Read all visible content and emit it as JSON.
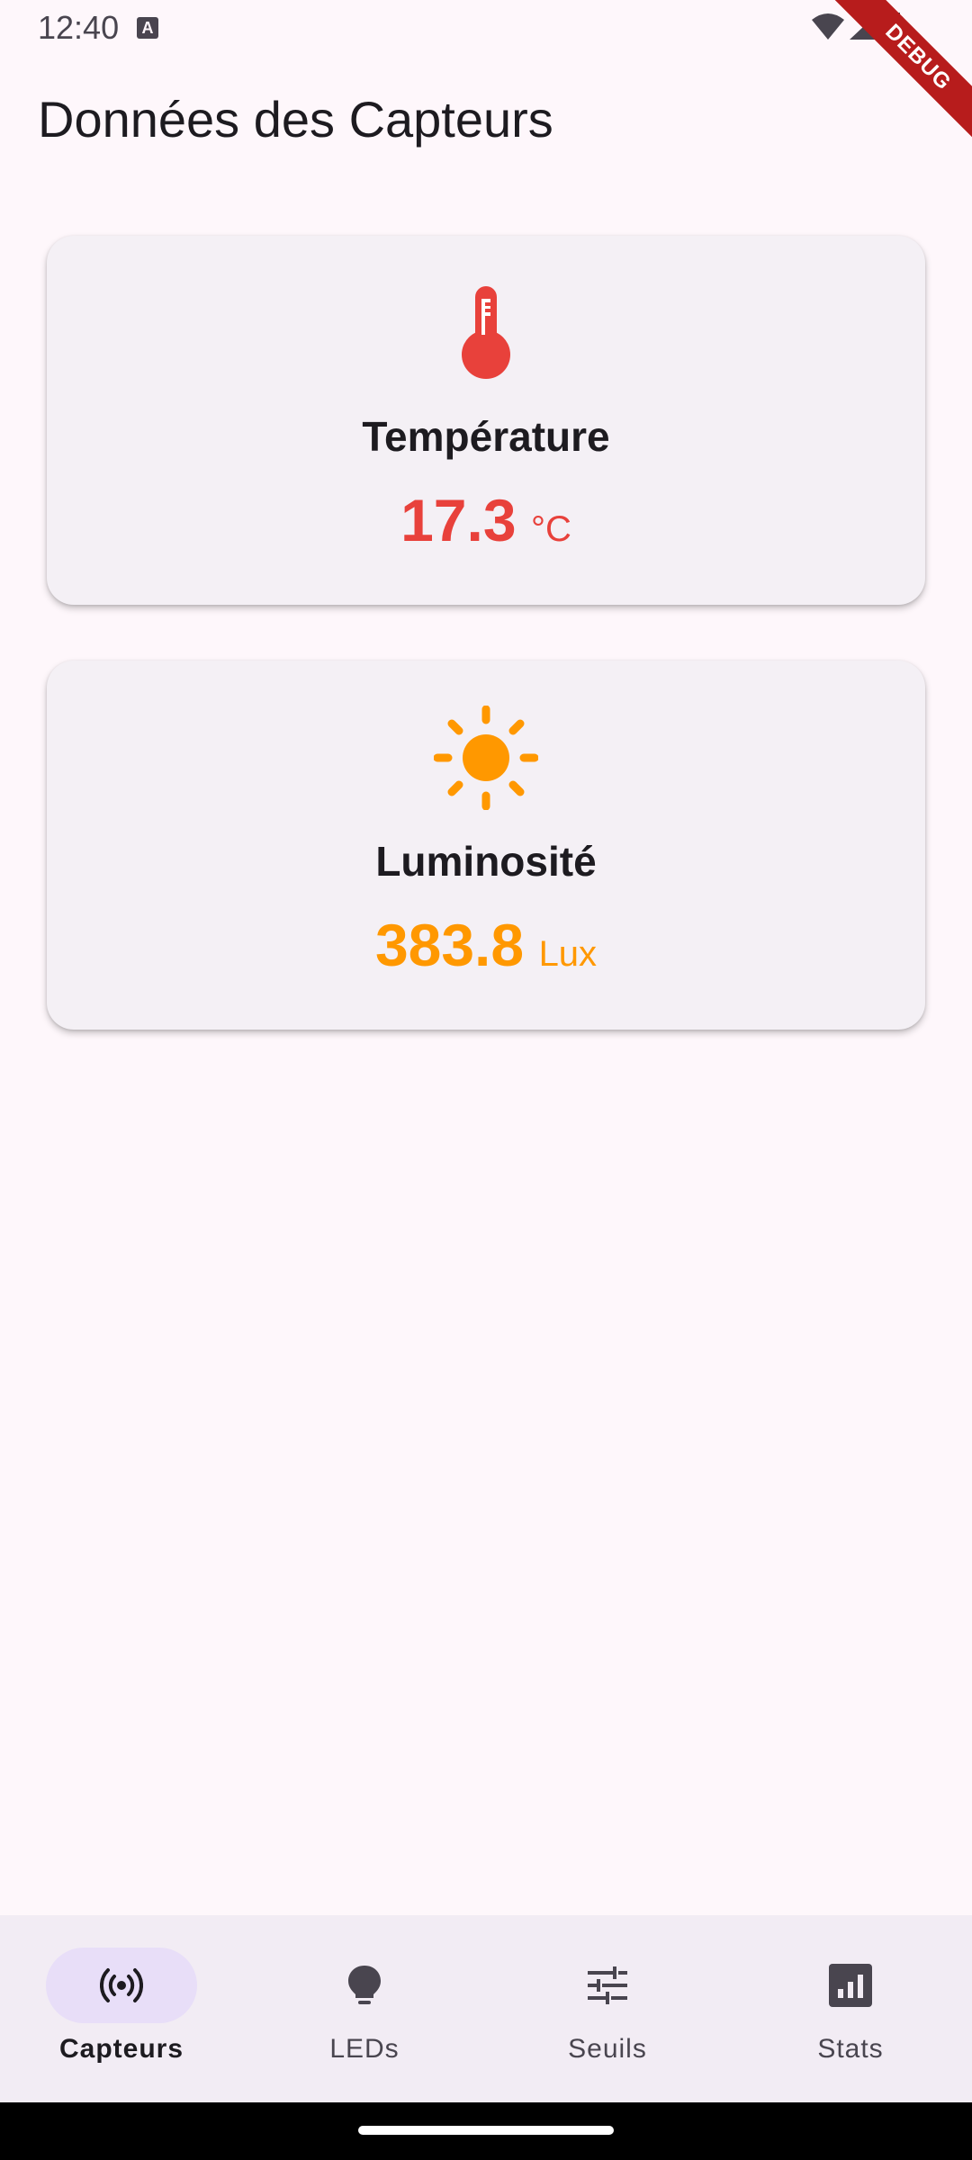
{
  "status_bar": {
    "time": "12:40",
    "notification_icon": "a-icon",
    "debug_label": "DEBUG"
  },
  "header": {
    "title": "Données des Capteurs"
  },
  "cards": [
    {
      "icon": "thermometer-icon",
      "label": "Température",
      "value": "17.3",
      "unit": "°C",
      "color": "#e8413b"
    },
    {
      "icon": "sun-icon",
      "label": "Luminosité",
      "value": "383.8",
      "unit": "Lux",
      "color": "#ff9800"
    }
  ],
  "nav": {
    "items": [
      {
        "label": "Capteurs",
        "icon": "sensors-icon",
        "active": true
      },
      {
        "label": "LEDs",
        "icon": "lightbulb-icon",
        "active": false
      },
      {
        "label": "Seuils",
        "icon": "tune-icon",
        "active": false
      },
      {
        "label": "Stats",
        "icon": "stats-icon",
        "active": false
      }
    ]
  }
}
